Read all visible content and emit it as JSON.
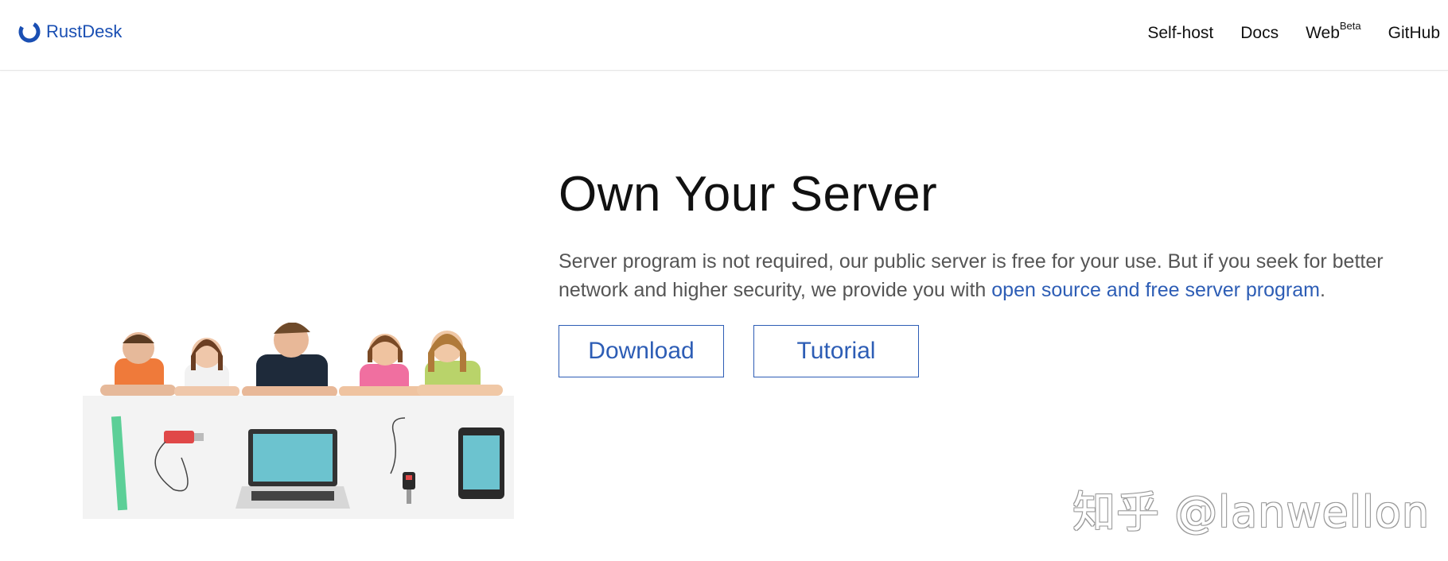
{
  "brand": {
    "name": "RustDesk",
    "logo_icon": "rustdesk-logo-icon",
    "color": "#1a4fb3"
  },
  "nav": {
    "items": [
      {
        "label": "Self-host"
      },
      {
        "label": "Docs"
      },
      {
        "label": "Web",
        "sup": "Beta"
      },
      {
        "label": "GitHub"
      }
    ]
  },
  "hero": {
    "title": "Own Your Server",
    "lead_prefix": "Server program is not required, our public server is free for your use. But if you seek for better network and higher security, we provide you with ",
    "lead_link": "open source and free server program",
    "lead_suffix": ".",
    "buttons": {
      "download": "Download",
      "tutorial": "Tutorial"
    },
    "accent": "#2d5db5",
    "image": "people-holding-sign-with-devices"
  },
  "watermark": "知乎 @lanwellon"
}
